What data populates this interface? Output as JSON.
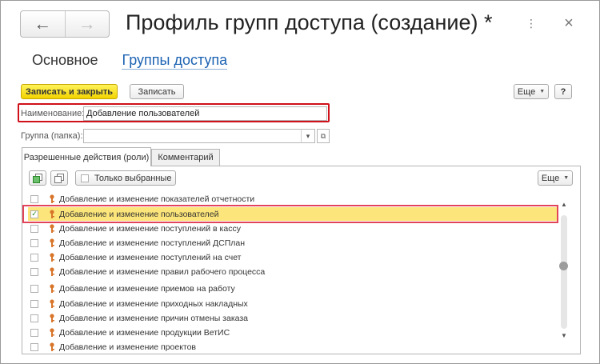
{
  "header": {
    "title": "Профиль групп доступа (создание) *",
    "back_icon": "←",
    "forward_icon": "→",
    "more_icon": "⋮",
    "close_icon": "×"
  },
  "tabs": {
    "main": "Основное",
    "link": "Группы доступа"
  },
  "toolbar": {
    "save_close": "Записать и закрыть",
    "save": "Записать",
    "more": "Еще",
    "help": "?"
  },
  "form": {
    "name_label": "Наименование:",
    "name_value": "Добавление пользователей",
    "group_label": "Группа (папка):",
    "group_value": "",
    "dropdown_icon": "▾",
    "open_icon": "⧉"
  },
  "inner_tabs": {
    "roles": "Разрешенные действия (роли)",
    "comment": "Комментарий"
  },
  "panel_toolbar": {
    "only_selected": "Только выбранные",
    "more": "Еще"
  },
  "list": {
    "items": [
      {
        "label": "Добавление и изменение показателей отчетности",
        "checked": false,
        "selected": false
      },
      {
        "label": "Добавление и изменение пользователей",
        "checked": true,
        "selected": true
      },
      {
        "label": "Добавление и изменение поступлений в кассу",
        "checked": false,
        "selected": false
      },
      {
        "label": "Добавление и изменение поступлений ДСПлан",
        "checked": false,
        "selected": false
      },
      {
        "label": "Добавление и изменение поступлений на счет",
        "checked": false,
        "selected": false
      },
      {
        "label": "Добавление и изменение правил рабочего процесса",
        "checked": false,
        "selected": false
      },
      {
        "label": "Добавление и изменение приемов на работу",
        "checked": false,
        "selected": false
      },
      {
        "label": "Добавление и изменение приходных накладных",
        "checked": false,
        "selected": false
      },
      {
        "label": "Добавление и изменение причин отмены заказа",
        "checked": false,
        "selected": false
      },
      {
        "label": "Добавление и изменение продукции ВетИС",
        "checked": false,
        "selected": false
      },
      {
        "label": "Добавление и изменение проектов",
        "checked": false,
        "selected": false
      }
    ]
  },
  "colors": {
    "accent_link": "#1d63b3",
    "primary_button": "#f2d300",
    "selected_row": "#fce57a",
    "highlight_red": "#d0101a",
    "key_icon": "#d8752a"
  }
}
